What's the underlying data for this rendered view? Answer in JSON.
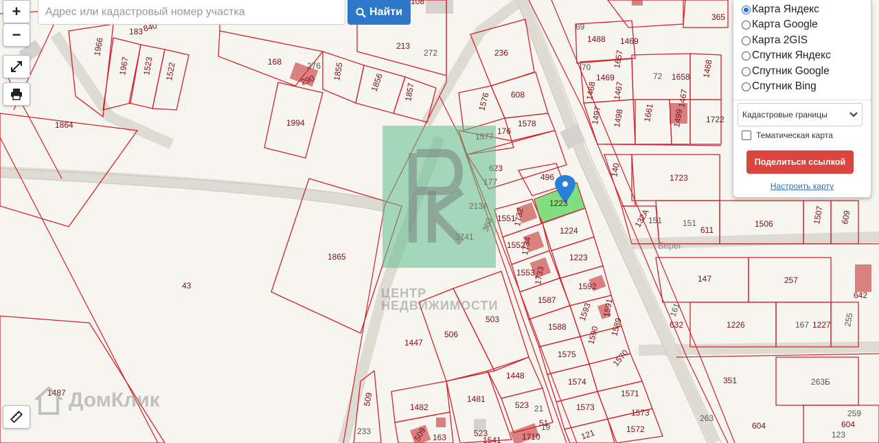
{
  "search": {
    "placeholder": "Адрес или кадастровый номер участка",
    "button_label": "Найти"
  },
  "controls": {
    "zoom_in": "+",
    "zoom_out": "−"
  },
  "layers": {
    "options": [
      {
        "label": "Карта Яндекс",
        "selected": true
      },
      {
        "label": "Карта Google",
        "selected": false
      },
      {
        "label": "Карта 2GIS",
        "selected": false
      },
      {
        "label": "Спутник Яндекс",
        "selected": false
      },
      {
        "label": "Спутник Google",
        "selected": false
      },
      {
        "label": "Спутник Bing",
        "selected": false
      }
    ],
    "boundary_select": "Кадастровые границы",
    "thematic_label": "Тематическая карта",
    "thematic_checked": false,
    "share_label": "Поделиться ссылкой",
    "configure_label": "Настроить карту"
  },
  "watermarks": {
    "rk_lines": [
      "ЦЕНТР",
      "НЕДВИЖИМОСТИ"
    ],
    "domclick": "ДомКлик"
  },
  "map": {
    "street_label": "Берег",
    "highlighted_parcel": "1223",
    "parcel_labels": [
      "108",
      "183",
      "840",
      "1966",
      "1967",
      "1523",
      "1522",
      "168",
      "276",
      "290",
      "1855",
      "1856",
      "1857",
      "213",
      "272",
      "236",
      "608",
      "1576",
      "1578",
      "176",
      "1577",
      "1864",
      "1994",
      "623",
      "177",
      "496",
      "1223",
      "1224",
      "1551",
      "1732",
      "1552",
      "1734",
      "1553",
      "1733",
      "213А",
      "360",
      "3741",
      "1865",
      "43",
      "1223",
      "1592",
      "1587",
      "1591",
      "1593",
      "1588",
      "1590",
      "1589",
      "1575",
      "1570",
      "1574",
      "1571",
      "1573",
      "1573",
      "1572",
      "121",
      "503",
      "506",
      "1447",
      "1448",
      "523",
      "1481",
      "1482",
      "163",
      "509",
      "509",
      "233",
      "523",
      "1541",
      "1710",
      "19",
      "21",
      "51",
      "1487",
      "69",
      "1488",
      "1469",
      "70",
      "1469",
      "1657",
      "72",
      "1658",
      "1468",
      "1468",
      "1467",
      "1497",
      "1498",
      "1661",
      "1499",
      "1467",
      "1722",
      "140",
      "1723",
      "132А",
      "151",
      "151",
      "611",
      "1506",
      "1507",
      "609",
      "147",
      "257",
      "642",
      "161",
      "632",
      "1226",
      "167",
      "1227",
      "255",
      "351",
      "263Б",
      "263",
      "604",
      "259",
      "604",
      "123",
      "365"
    ],
    "plain_labels": [
      "255",
      "263Б",
      "263",
      "259",
      "123",
      "72",
      "69",
      "70",
      "272",
      "276",
      "233",
      "19",
      "21",
      "151",
      "167",
      "161"
    ]
  },
  "colors": {
    "boundary": "#d4202a",
    "highlight": "#7ee07e",
    "pin": "#2b7fd6",
    "share": "#d9453f",
    "search": "#2f77c8",
    "building": "#d98080"
  }
}
